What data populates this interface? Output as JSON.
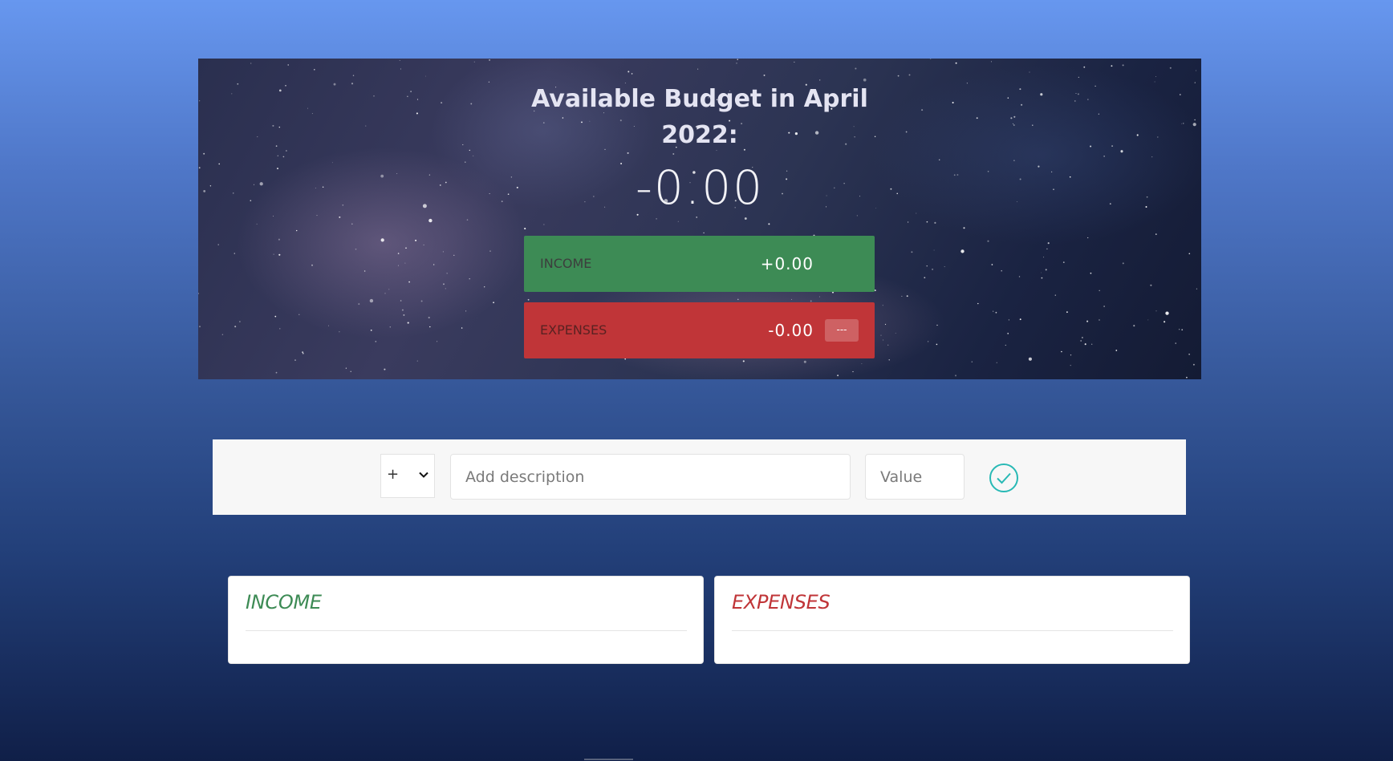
{
  "budget": {
    "title": "Available Budget in April 2022:",
    "value": "-0.00"
  },
  "summary": {
    "income": {
      "label": "INCOME",
      "value": "+0.00"
    },
    "expenses": {
      "label": "EXPENSES",
      "value": "-0.00",
      "percentage": "---"
    }
  },
  "add_form": {
    "type_options": [
      "+",
      "-"
    ],
    "type_selected": "+",
    "description_placeholder": "Add description",
    "value_placeholder": "Value",
    "submit_icon": "check-circle-icon"
  },
  "lists": {
    "income": {
      "title": "INCOME",
      "items": []
    },
    "expenses": {
      "title": "EXPENSES",
      "items": []
    }
  },
  "colors": {
    "income": "#3d8b55",
    "expenses": "#c03538",
    "accent": "#28b9b5"
  }
}
